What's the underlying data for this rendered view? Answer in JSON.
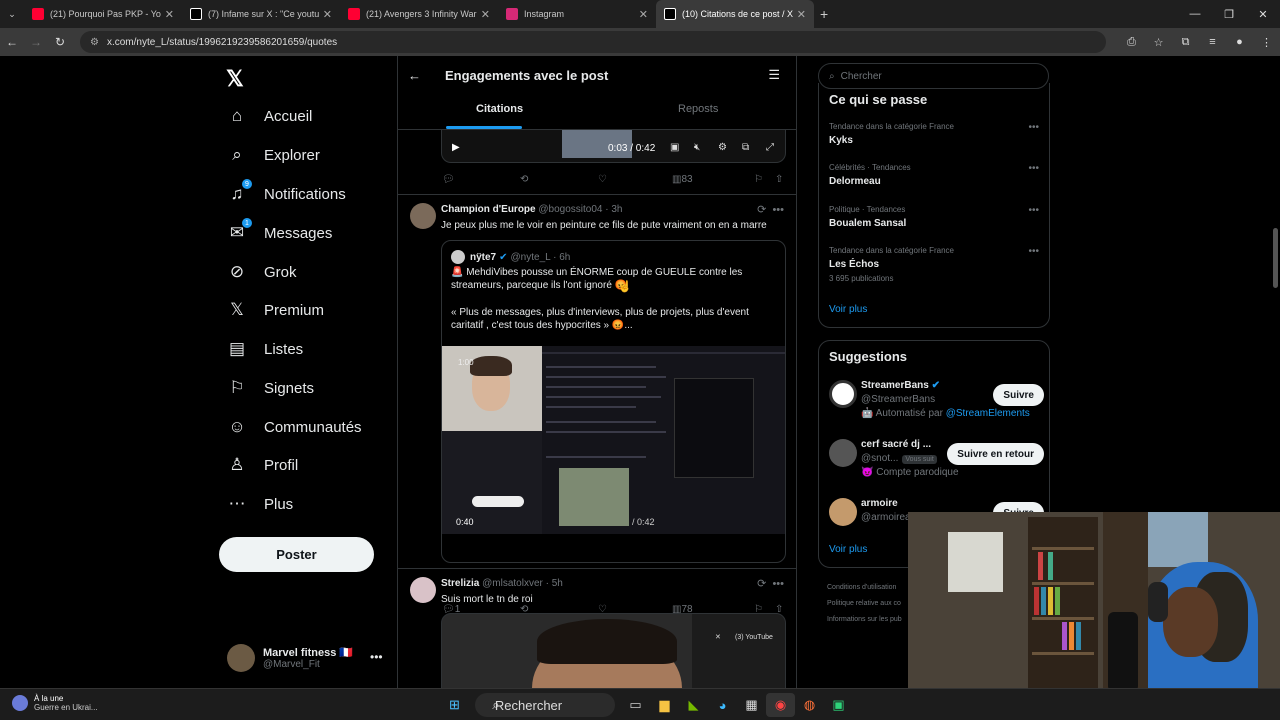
{
  "browser": {
    "tabs": [
      {
        "title": "(21) Pourquoi Pas PKP - YouTube",
        "color": "#ff0033"
      },
      {
        "title": "(7) Infame sur X : \"Ce youtubeur",
        "color": "#ffffff"
      },
      {
        "title": "(21) Avengers 3 Infinity War : cli",
        "color": "#ff0033"
      },
      {
        "title": "Instagram",
        "color": "#d62976"
      },
      {
        "title": "(10) Citations de ce post / X",
        "color": "#ffffff"
      }
    ],
    "url": "x.com/nyte_L/status/1996219239586201659/quotes"
  },
  "sidebar": {
    "items": [
      {
        "label": "Accueil",
        "icon": "home-icon",
        "glyph": "⌂"
      },
      {
        "label": "Explorer",
        "icon": "search-icon",
        "glyph": "⌕"
      },
      {
        "label": "Notifications",
        "icon": "bell-icon",
        "glyph": "♫",
        "badge": "9"
      },
      {
        "label": "Messages",
        "icon": "envelope-icon",
        "glyph": "✉",
        "badge": "1"
      },
      {
        "label": "Grok",
        "icon": "grok-icon",
        "glyph": "⊘"
      },
      {
        "label": "Premium",
        "icon": "x-premium-icon",
        "glyph": "𝕏"
      },
      {
        "label": "Listes",
        "icon": "list-icon",
        "glyph": "▤"
      },
      {
        "label": "Signets",
        "icon": "bookmark-icon",
        "glyph": "⚐"
      },
      {
        "label": "Communautés",
        "icon": "people-icon",
        "glyph": "☺"
      },
      {
        "label": "Profil",
        "icon": "person-icon",
        "glyph": "♙"
      },
      {
        "label": "Plus",
        "icon": "more-circle-icon",
        "glyph": "⋯"
      }
    ],
    "post_label": "Poster",
    "me": {
      "name": "Marvel fitness 🇫🇷",
      "handle": "@Marvel_Fit"
    }
  },
  "center": {
    "title": "Engagements avec le post",
    "tabs": [
      "Citations",
      "Reposts"
    ],
    "video_time": "0:03 / 0:42",
    "top_actions": {
      "views": "83"
    },
    "post1": {
      "name": "Champion d'Europe",
      "handle": "@bogossito04 · 3h",
      "text": "Je peux plus me le voir en peinture ce fils de pute vraiment on en a marre",
      "quote": {
        "name": "nÿte7",
        "handle": "@nyte_L · 6h",
        "text1": "🚨 MehdiVibes pousse un ÉNORME coup de GUEULE contre les streameurs, parceque ils l'ont ignoré 😡",
        "text2": "« Plus de messages, plus d'interviews, plus de projets, plus d'event caritatif , c'est tous des hypocrites » 😡...",
        "video_time": "0:40",
        "video_total": "/ 0:42",
        "cam_label": "1:00"
      },
      "actions": {
        "replies": "1",
        "views": "78"
      }
    },
    "post2": {
      "name": "Strelizia",
      "handle": "@mlsatolxver · 5h",
      "text": "Suis mort le tn de roi",
      "media_label": "(3) YouTube"
    }
  },
  "right": {
    "search_placeholder": "Chercher",
    "trends_title": "Ce qui se passe",
    "trends": [
      {
        "category": "Tendance dans la catégorie France",
        "name": "Kyks",
        "posts": ""
      },
      {
        "category": "Célébrités · Tendances",
        "name": "Delormeau",
        "posts": ""
      },
      {
        "category": "Politique · Tendances",
        "name": "Boualem Sansal",
        "posts": ""
      },
      {
        "category": "Tendance dans la catégorie France",
        "name": "Les Échos",
        "posts": "3 695 publications"
      }
    ],
    "see_more": "Voir plus",
    "sugg_title": "Suggestions",
    "suggestions": [
      {
        "name": "StreamerBans",
        "handle": "@StreamerBans",
        "extra": "🤖 Automatisé par ",
        "extra_link": "@StreamElements",
        "button": "Suivre",
        "color": "#ffffff"
      },
      {
        "name": "cerf sacré dj ...",
        "handle": "@snot...",
        "you_follow": "Vous suit",
        "extra": "😈 Compte parodique",
        "extra_link": "",
        "button": "Suivre en retour",
        "color": "#555555"
      },
      {
        "name": "armoire",
        "handle": "@armoirea",
        "extra": "",
        "extra_link": "",
        "button": "Suivre",
        "color": "#c49a6c"
      }
    ],
    "footer": [
      "Conditions d'utilisation",
      "Politique relative aux co",
      "Informations sur les pub"
    ]
  },
  "taskbar": {
    "weather_title": "À la une",
    "weather_sub": "Guerre en Ukrai...",
    "search": "Rechercher"
  }
}
